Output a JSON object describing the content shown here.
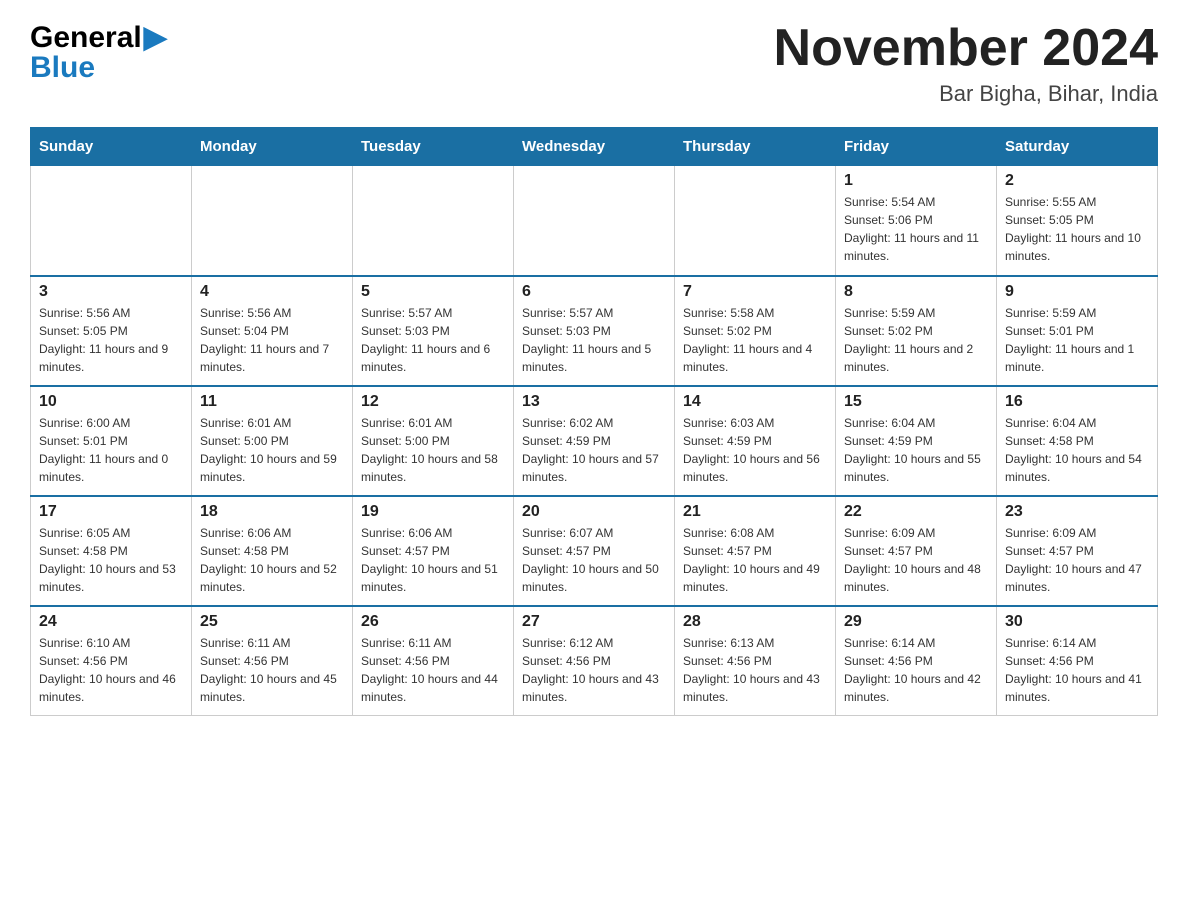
{
  "header": {
    "logo_general": "General",
    "logo_blue": "Blue",
    "month_title": "November 2024",
    "location": "Bar Bigha, Bihar, India"
  },
  "weekdays": [
    "Sunday",
    "Monday",
    "Tuesday",
    "Wednesday",
    "Thursday",
    "Friday",
    "Saturday"
  ],
  "weeks": [
    [
      {
        "day": "",
        "info": ""
      },
      {
        "day": "",
        "info": ""
      },
      {
        "day": "",
        "info": ""
      },
      {
        "day": "",
        "info": ""
      },
      {
        "day": "",
        "info": ""
      },
      {
        "day": "1",
        "info": "Sunrise: 5:54 AM\nSunset: 5:06 PM\nDaylight: 11 hours and 11 minutes."
      },
      {
        "day": "2",
        "info": "Sunrise: 5:55 AM\nSunset: 5:05 PM\nDaylight: 11 hours and 10 minutes."
      }
    ],
    [
      {
        "day": "3",
        "info": "Sunrise: 5:56 AM\nSunset: 5:05 PM\nDaylight: 11 hours and 9 minutes."
      },
      {
        "day": "4",
        "info": "Sunrise: 5:56 AM\nSunset: 5:04 PM\nDaylight: 11 hours and 7 minutes."
      },
      {
        "day": "5",
        "info": "Sunrise: 5:57 AM\nSunset: 5:03 PM\nDaylight: 11 hours and 6 minutes."
      },
      {
        "day": "6",
        "info": "Sunrise: 5:57 AM\nSunset: 5:03 PM\nDaylight: 11 hours and 5 minutes."
      },
      {
        "day": "7",
        "info": "Sunrise: 5:58 AM\nSunset: 5:02 PM\nDaylight: 11 hours and 4 minutes."
      },
      {
        "day": "8",
        "info": "Sunrise: 5:59 AM\nSunset: 5:02 PM\nDaylight: 11 hours and 2 minutes."
      },
      {
        "day": "9",
        "info": "Sunrise: 5:59 AM\nSunset: 5:01 PM\nDaylight: 11 hours and 1 minute."
      }
    ],
    [
      {
        "day": "10",
        "info": "Sunrise: 6:00 AM\nSunset: 5:01 PM\nDaylight: 11 hours and 0 minutes."
      },
      {
        "day": "11",
        "info": "Sunrise: 6:01 AM\nSunset: 5:00 PM\nDaylight: 10 hours and 59 minutes."
      },
      {
        "day": "12",
        "info": "Sunrise: 6:01 AM\nSunset: 5:00 PM\nDaylight: 10 hours and 58 minutes."
      },
      {
        "day": "13",
        "info": "Sunrise: 6:02 AM\nSunset: 4:59 PM\nDaylight: 10 hours and 57 minutes."
      },
      {
        "day": "14",
        "info": "Sunrise: 6:03 AM\nSunset: 4:59 PM\nDaylight: 10 hours and 56 minutes."
      },
      {
        "day": "15",
        "info": "Sunrise: 6:04 AM\nSunset: 4:59 PM\nDaylight: 10 hours and 55 minutes."
      },
      {
        "day": "16",
        "info": "Sunrise: 6:04 AM\nSunset: 4:58 PM\nDaylight: 10 hours and 54 minutes."
      }
    ],
    [
      {
        "day": "17",
        "info": "Sunrise: 6:05 AM\nSunset: 4:58 PM\nDaylight: 10 hours and 53 minutes."
      },
      {
        "day": "18",
        "info": "Sunrise: 6:06 AM\nSunset: 4:58 PM\nDaylight: 10 hours and 52 minutes."
      },
      {
        "day": "19",
        "info": "Sunrise: 6:06 AM\nSunset: 4:57 PM\nDaylight: 10 hours and 51 minutes."
      },
      {
        "day": "20",
        "info": "Sunrise: 6:07 AM\nSunset: 4:57 PM\nDaylight: 10 hours and 50 minutes."
      },
      {
        "day": "21",
        "info": "Sunrise: 6:08 AM\nSunset: 4:57 PM\nDaylight: 10 hours and 49 minutes."
      },
      {
        "day": "22",
        "info": "Sunrise: 6:09 AM\nSunset: 4:57 PM\nDaylight: 10 hours and 48 minutes."
      },
      {
        "day": "23",
        "info": "Sunrise: 6:09 AM\nSunset: 4:57 PM\nDaylight: 10 hours and 47 minutes."
      }
    ],
    [
      {
        "day": "24",
        "info": "Sunrise: 6:10 AM\nSunset: 4:56 PM\nDaylight: 10 hours and 46 minutes."
      },
      {
        "day": "25",
        "info": "Sunrise: 6:11 AM\nSunset: 4:56 PM\nDaylight: 10 hours and 45 minutes."
      },
      {
        "day": "26",
        "info": "Sunrise: 6:11 AM\nSunset: 4:56 PM\nDaylight: 10 hours and 44 minutes."
      },
      {
        "day": "27",
        "info": "Sunrise: 6:12 AM\nSunset: 4:56 PM\nDaylight: 10 hours and 43 minutes."
      },
      {
        "day": "28",
        "info": "Sunrise: 6:13 AM\nSunset: 4:56 PM\nDaylight: 10 hours and 43 minutes."
      },
      {
        "day": "29",
        "info": "Sunrise: 6:14 AM\nSunset: 4:56 PM\nDaylight: 10 hours and 42 minutes."
      },
      {
        "day": "30",
        "info": "Sunrise: 6:14 AM\nSunset: 4:56 PM\nDaylight: 10 hours and 41 minutes."
      }
    ]
  ]
}
